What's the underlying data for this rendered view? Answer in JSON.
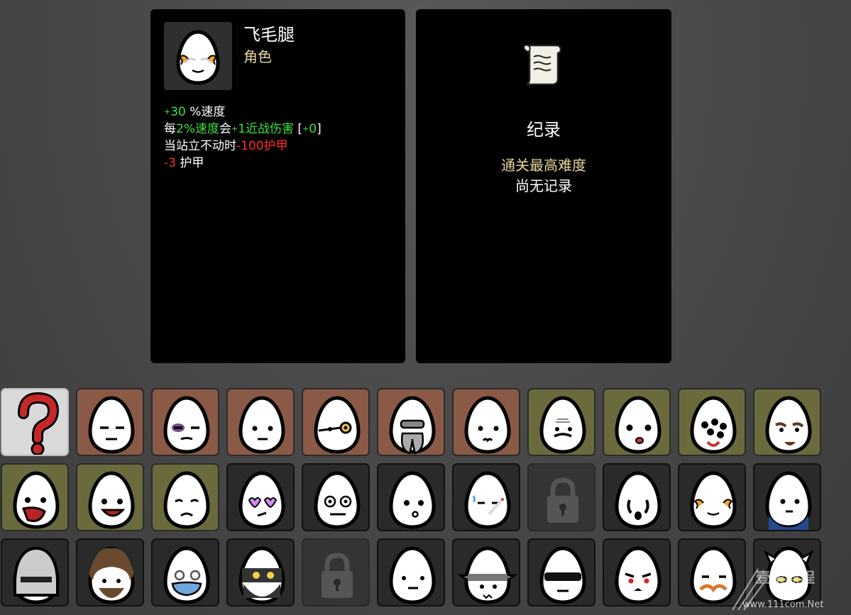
{
  "character": {
    "name": "飞毛腿",
    "type": "角色",
    "stats": [
      [
        {
          "t": "+",
          "c": "g",
          "s": true
        },
        {
          "t": "30",
          "c": "g"
        },
        {
          "t": " %速度",
          "c": "w"
        }
      ],
      [
        {
          "t": "每",
          "c": "w"
        },
        {
          "t": "2%速度",
          "c": "g"
        },
        {
          "t": "会",
          "c": "w"
        },
        {
          "t": "+",
          "c": "g",
          "s": true
        },
        {
          "t": "1近战伤害",
          "c": "g"
        },
        {
          "t": " [",
          "c": "w"
        },
        {
          "t": "+",
          "c": "g",
          "s": true
        },
        {
          "t": "0",
          "c": "g"
        },
        {
          "t": "]",
          "c": "w"
        }
      ],
      [
        {
          "t": "当站立不动时",
          "c": "w"
        },
        {
          "t": "-100护甲",
          "c": "r"
        }
      ],
      [
        {
          "t": "-3",
          "c": "r"
        },
        {
          "t": " 护甲",
          "c": "w"
        }
      ]
    ]
  },
  "record": {
    "title": "纪录",
    "label": "通关最高难度",
    "value": "尚无记录"
  },
  "colors": {
    "tier_danger": "#8a5a47",
    "tier_olive": "#6b6a3c",
    "tier_normal": "#2a2a2a",
    "tier_locked": "#343434",
    "random": "#d9d9d9",
    "stat_positive": "#3ee03e",
    "stat_negative": "#ff2b2b",
    "label_gold": "#e8d79f"
  },
  "roster": [
    {
      "id": "random",
      "tier": "random",
      "face": "question-mark-icon"
    },
    {
      "id": "c2",
      "tier": "danger",
      "face": "frown"
    },
    {
      "id": "c3",
      "tier": "danger",
      "face": "bruised-eye"
    },
    {
      "id": "c4",
      "tier": "danger",
      "face": "neutral"
    },
    {
      "id": "c5",
      "tier": "danger",
      "face": "monocle"
    },
    {
      "id": "c6",
      "tier": "danger",
      "face": "beard-goggles"
    },
    {
      "id": "c7",
      "tier": "danger",
      "face": "pout"
    },
    {
      "id": "c8",
      "tier": "olive",
      "face": "old-mustache"
    },
    {
      "id": "c9",
      "tier": "olive",
      "face": "surprised"
    },
    {
      "id": "c10",
      "tier": "olive",
      "face": "many-eyes"
    },
    {
      "id": "c11",
      "tier": "olive",
      "face": "bearded"
    },
    {
      "id": "c12",
      "tier": "olive",
      "face": "screaming"
    },
    {
      "id": "c13",
      "tier": "olive",
      "face": "happy"
    },
    {
      "id": "c14",
      "tier": "olive",
      "face": "sad"
    },
    {
      "id": "c15",
      "tier": "normal",
      "face": "heart-glasses"
    },
    {
      "id": "c16",
      "tier": "normal",
      "face": "derp"
    },
    {
      "id": "c17",
      "tier": "normal",
      "face": "kiss"
    },
    {
      "id": "c18",
      "tier": "normal",
      "face": "sweat-cigar"
    },
    {
      "id": "c19",
      "tier": "locked",
      "face": "lock-icon"
    },
    {
      "id": "c20",
      "tier": "normal",
      "face": "ghost"
    },
    {
      "id": "c21",
      "tier": "normal",
      "face": "speedy",
      "selected": true
    },
    {
      "id": "c22",
      "tier": "normal",
      "face": "suit"
    },
    {
      "id": "c23",
      "tier": "normal",
      "face": "knight-helmet"
    },
    {
      "id": "c24",
      "tier": "normal",
      "face": "hairy"
    },
    {
      "id": "c25",
      "tier": "normal",
      "face": "medic-mask"
    },
    {
      "id": "c26",
      "tier": "normal",
      "face": "ninja"
    },
    {
      "id": "c27",
      "tier": "locked",
      "face": "lock-icon"
    },
    {
      "id": "c28",
      "tier": "normal",
      "face": "blank"
    },
    {
      "id": "c29",
      "tier": "normal",
      "face": "spiked"
    },
    {
      "id": "c30",
      "tier": "normal",
      "face": "visor"
    },
    {
      "id": "c31",
      "tier": "normal",
      "face": "angry"
    },
    {
      "id": "c32",
      "tier": "normal",
      "face": "mustache-smug"
    },
    {
      "id": "c33",
      "tier": "normal",
      "face": "horned"
    }
  ],
  "watermark": {
    "text": "壹聚教程",
    "url": "www.111com.Net"
  }
}
